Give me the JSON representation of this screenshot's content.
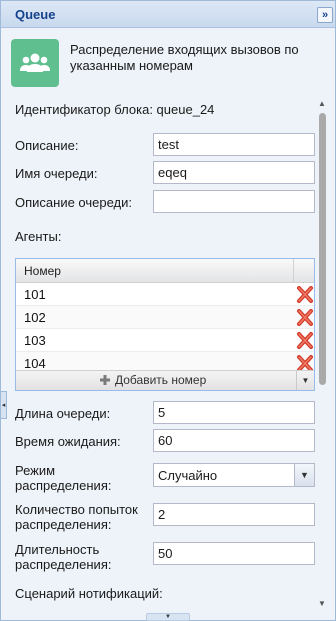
{
  "panel": {
    "title": "Queue",
    "collapse_icon": "double-chevron-right-icon"
  },
  "block": {
    "icon": "users-group-icon",
    "icon_color": "#5fbf8f",
    "description": "Распределение входящих вызовов по указанным номерам"
  },
  "form": {
    "block_id": "Идентификатор блока: queue_24",
    "description_label": "Описание:",
    "description_value": "test",
    "queue_name_label": "Имя очереди:",
    "queue_name_value": "eqeq",
    "queue_description_label": "Описание очереди:",
    "queue_description_value": "",
    "agents_label": "Агенты:",
    "queue_length_label": "Длина очереди:",
    "queue_length_value": "5",
    "wait_time_label": "Время ожидания:",
    "wait_time_value": "60",
    "distribution_mode_label_1": "Режим",
    "distribution_mode_label_2": "распределения:",
    "distribution_mode_value": "Случайно",
    "attempts_label_1": "Количество попыток",
    "attempts_label_2": "распределения:",
    "attempts_value": "2",
    "duration_label_1": "Длительность",
    "duration_label_2": "распределения:",
    "duration_value": "50",
    "notification_scenario_label": "Сценарий нотификаций:"
  },
  "agents_grid": {
    "column_header": "Номер",
    "rows": [
      "101",
      "102",
      "103",
      "104"
    ],
    "delete_icon": "red-x-delete-icon",
    "add_label": "Добавить номер"
  }
}
